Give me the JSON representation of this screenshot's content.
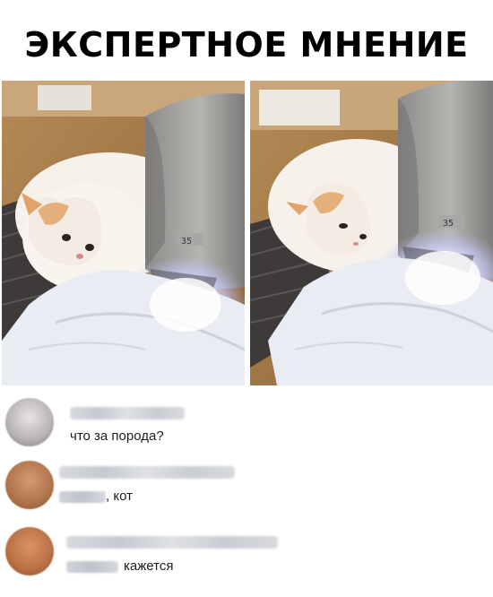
{
  "title": "ЭКСПЕРТНОЕ МНЕНИЕ",
  "photos": [
    {
      "icon": "cat-photo-left"
    },
    {
      "icon": "cat-photo-right"
    }
  ],
  "comments": [
    {
      "text": "что за порода?",
      "avatar_color": "#b7b2b5"
    },
    {
      "text": ", кот",
      "avatar_color": "#b0734a"
    },
    {
      "text": "кажется",
      "avatar_color": "#b87044"
    }
  ]
}
